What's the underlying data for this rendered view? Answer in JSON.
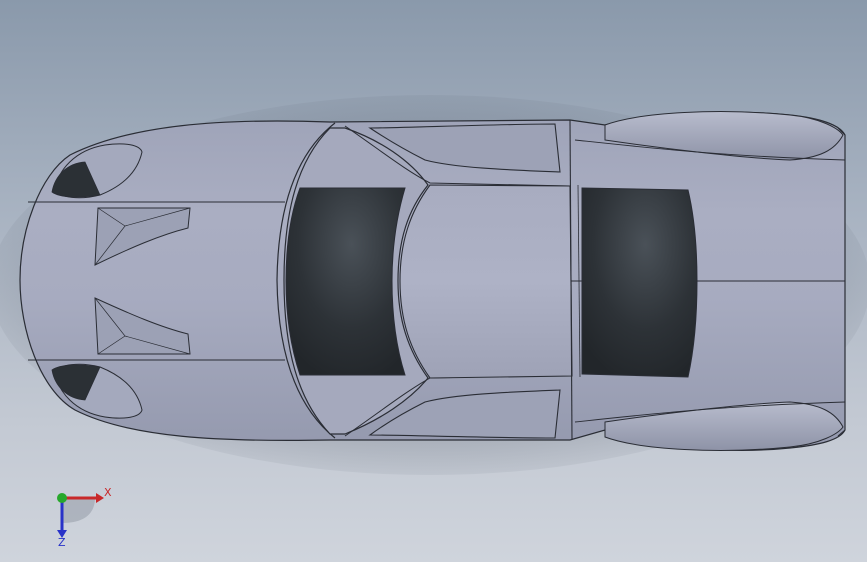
{
  "app": {
    "view": "Top",
    "model": "car body"
  },
  "triad": {
    "x_label": "X",
    "z_label": "Z",
    "x_color": "#c8282a",
    "y_color": "#27a82c",
    "z_color": "#2832c8"
  },
  "colors": {
    "body": "#a3a8bc",
    "body_shadow": "#8b90a5",
    "glass": "#2b3035",
    "edge": "#2a2d35"
  }
}
